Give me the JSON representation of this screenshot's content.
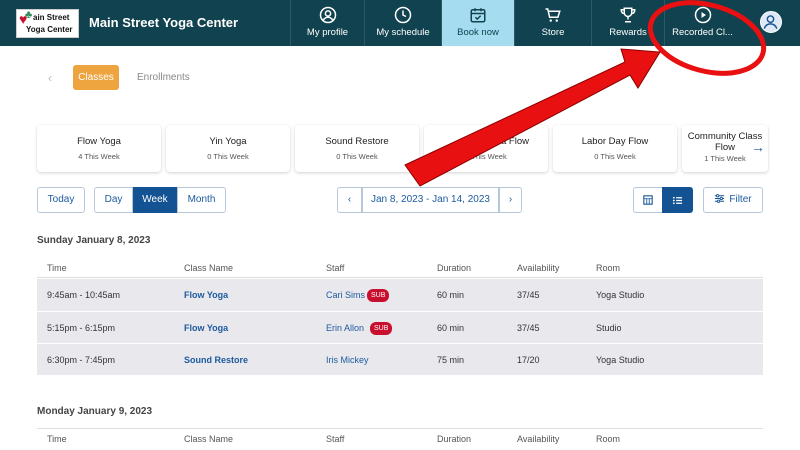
{
  "header": {
    "logo_line1": "ain Street",
    "logo_line2": "Yoga Center",
    "brand": "Main Street Yoga Center",
    "nav": [
      {
        "label": "My profile",
        "icon": "user-circle-icon"
      },
      {
        "label": "My schedule",
        "icon": "clock-icon"
      },
      {
        "label": "Book now",
        "icon": "calendar-check-icon",
        "active": true
      },
      {
        "label": "Store",
        "icon": "cart-icon"
      },
      {
        "label": "Rewards",
        "icon": "trophy-icon"
      },
      {
        "label": "Recorded Cl...",
        "icon": "play-circle-icon"
      }
    ],
    "avatar_icon": "avatar-icon"
  },
  "tabs": {
    "classes": "Classes",
    "enrollments": "Enrollments"
  },
  "cards": [
    {
      "title": "Flow Yoga",
      "sub": "4 This Week"
    },
    {
      "title": "Yin Yoga",
      "sub": "0 This Week"
    },
    {
      "title": "Sound Restore",
      "sub": "0 This Week"
    },
    {
      "title": "...asa Flow",
      "sub": "1 This Week"
    },
    {
      "title": "Labor Day Flow",
      "sub": "0 This Week"
    },
    {
      "title": "Community Class Flow",
      "sub": "1 This Week"
    }
  ],
  "controls": {
    "today": "Today",
    "day": "Day",
    "week": "Week",
    "month": "Month",
    "date_range": "Jan 8, 2023 - Jan 14, 2023",
    "filter": "Filter"
  },
  "columns": [
    "Time",
    "Class Name",
    "Staff",
    "Duration",
    "Availability",
    "Room"
  ],
  "days": [
    {
      "heading": "Sunday January 8, 2023",
      "rows": [
        {
          "time": "9:45am - 10:45am",
          "class": "Flow Yoga",
          "staff": "Cari Sims",
          "sub": "SUB",
          "duration": "60 min",
          "availability": "37/45",
          "room": "Yoga Studio"
        },
        {
          "time": "5:15pm - 6:15pm",
          "class": "Flow Yoga",
          "staff": "Erin Allon",
          "sub": "SUB",
          "duration": "60 min",
          "availability": "37/45",
          "room": "Studio"
        },
        {
          "time": "6:30pm - 7:45pm",
          "class": "Sound Restore",
          "staff": "Iris Mickey",
          "sub": "",
          "duration": "75 min",
          "availability": "17/20",
          "room": "Yoga Studio"
        }
      ]
    },
    {
      "heading": "Monday January 9, 2023",
      "rows": []
    }
  ],
  "annotation_color": "#e81010",
  "colors": {
    "topbar": "#11424f",
    "active_nav": "#a5dcef",
    "accent_orange": "#eea43f",
    "primary_blue": "#135293",
    "sub_red": "#c8102e"
  }
}
